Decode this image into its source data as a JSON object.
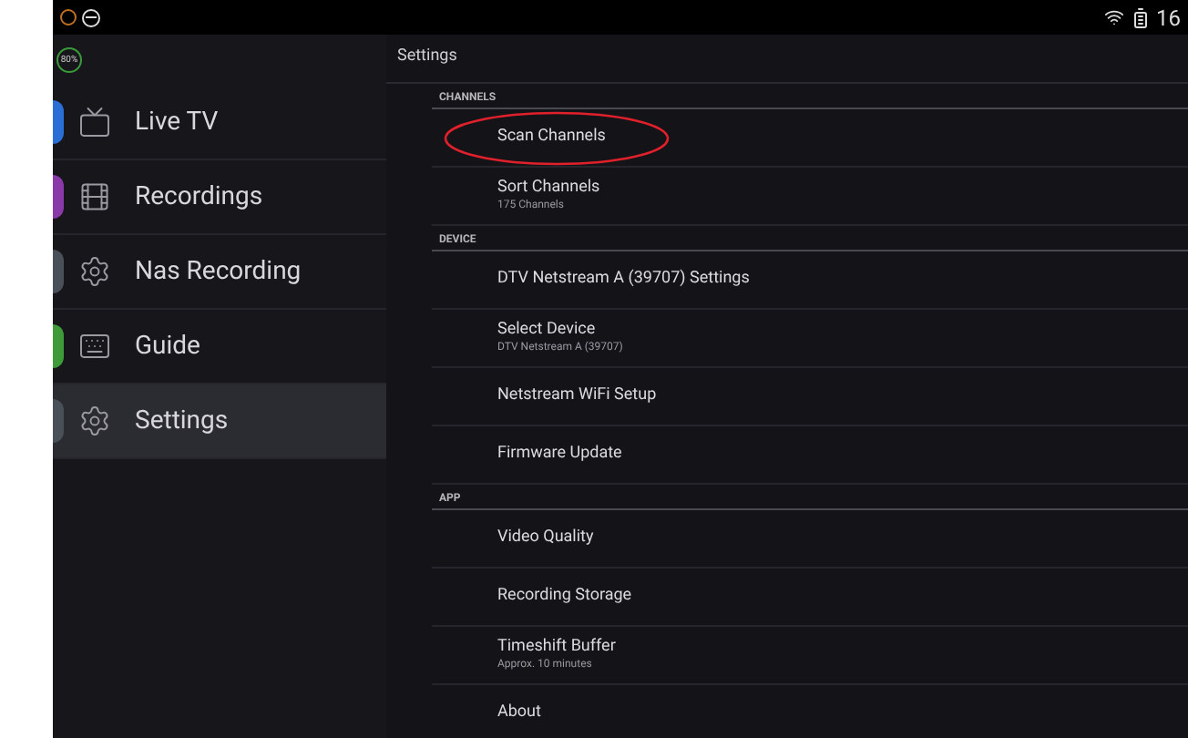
{
  "status_bar": {
    "battery_badge": "80%",
    "time": "16"
  },
  "sidebar": {
    "items": [
      {
        "label": "Live TV",
        "kind": "tv",
        "color": "#2a6fd6",
        "selected": false
      },
      {
        "label": "Recordings",
        "kind": "film",
        "color": "#8a3aa8",
        "selected": false
      },
      {
        "label": "Nas Recording",
        "kind": "gear",
        "color": "#4a5058",
        "selected": false
      },
      {
        "label": "Guide",
        "kind": "keyboard",
        "color": "#3f9a3a",
        "selected": false
      },
      {
        "label": "Settings",
        "kind": "gear",
        "color": "#4a5058",
        "selected": true
      }
    ]
  },
  "header": {
    "title": "Settings"
  },
  "sections": [
    {
      "title": "CHANNELS",
      "items": [
        {
          "title": "Scan Channels",
          "highlighted": true
        },
        {
          "title": "Sort Channels",
          "subtitle": "175 Channels",
          "highlighted": false
        }
      ]
    },
    {
      "title": "DEVICE",
      "items": [
        {
          "title": "DTV Netstream A (39707) Settings",
          "highlighted": false
        },
        {
          "title": "Select Device",
          "subtitle": "DTV Netstream A (39707)",
          "highlighted": false
        },
        {
          "title": "Netstream WiFi Setup",
          "highlighted": false
        },
        {
          "title": "Firmware Update",
          "highlighted": false
        }
      ]
    },
    {
      "title": "APP",
      "items": [
        {
          "title": "Video Quality",
          "highlighted": false
        },
        {
          "title": "Recording Storage",
          "highlighted": false
        },
        {
          "title": "Timeshift Buffer",
          "subtitle": "Approx. 10 minutes",
          "highlighted": false
        },
        {
          "title": "About",
          "highlighted": false
        }
      ]
    }
  ]
}
